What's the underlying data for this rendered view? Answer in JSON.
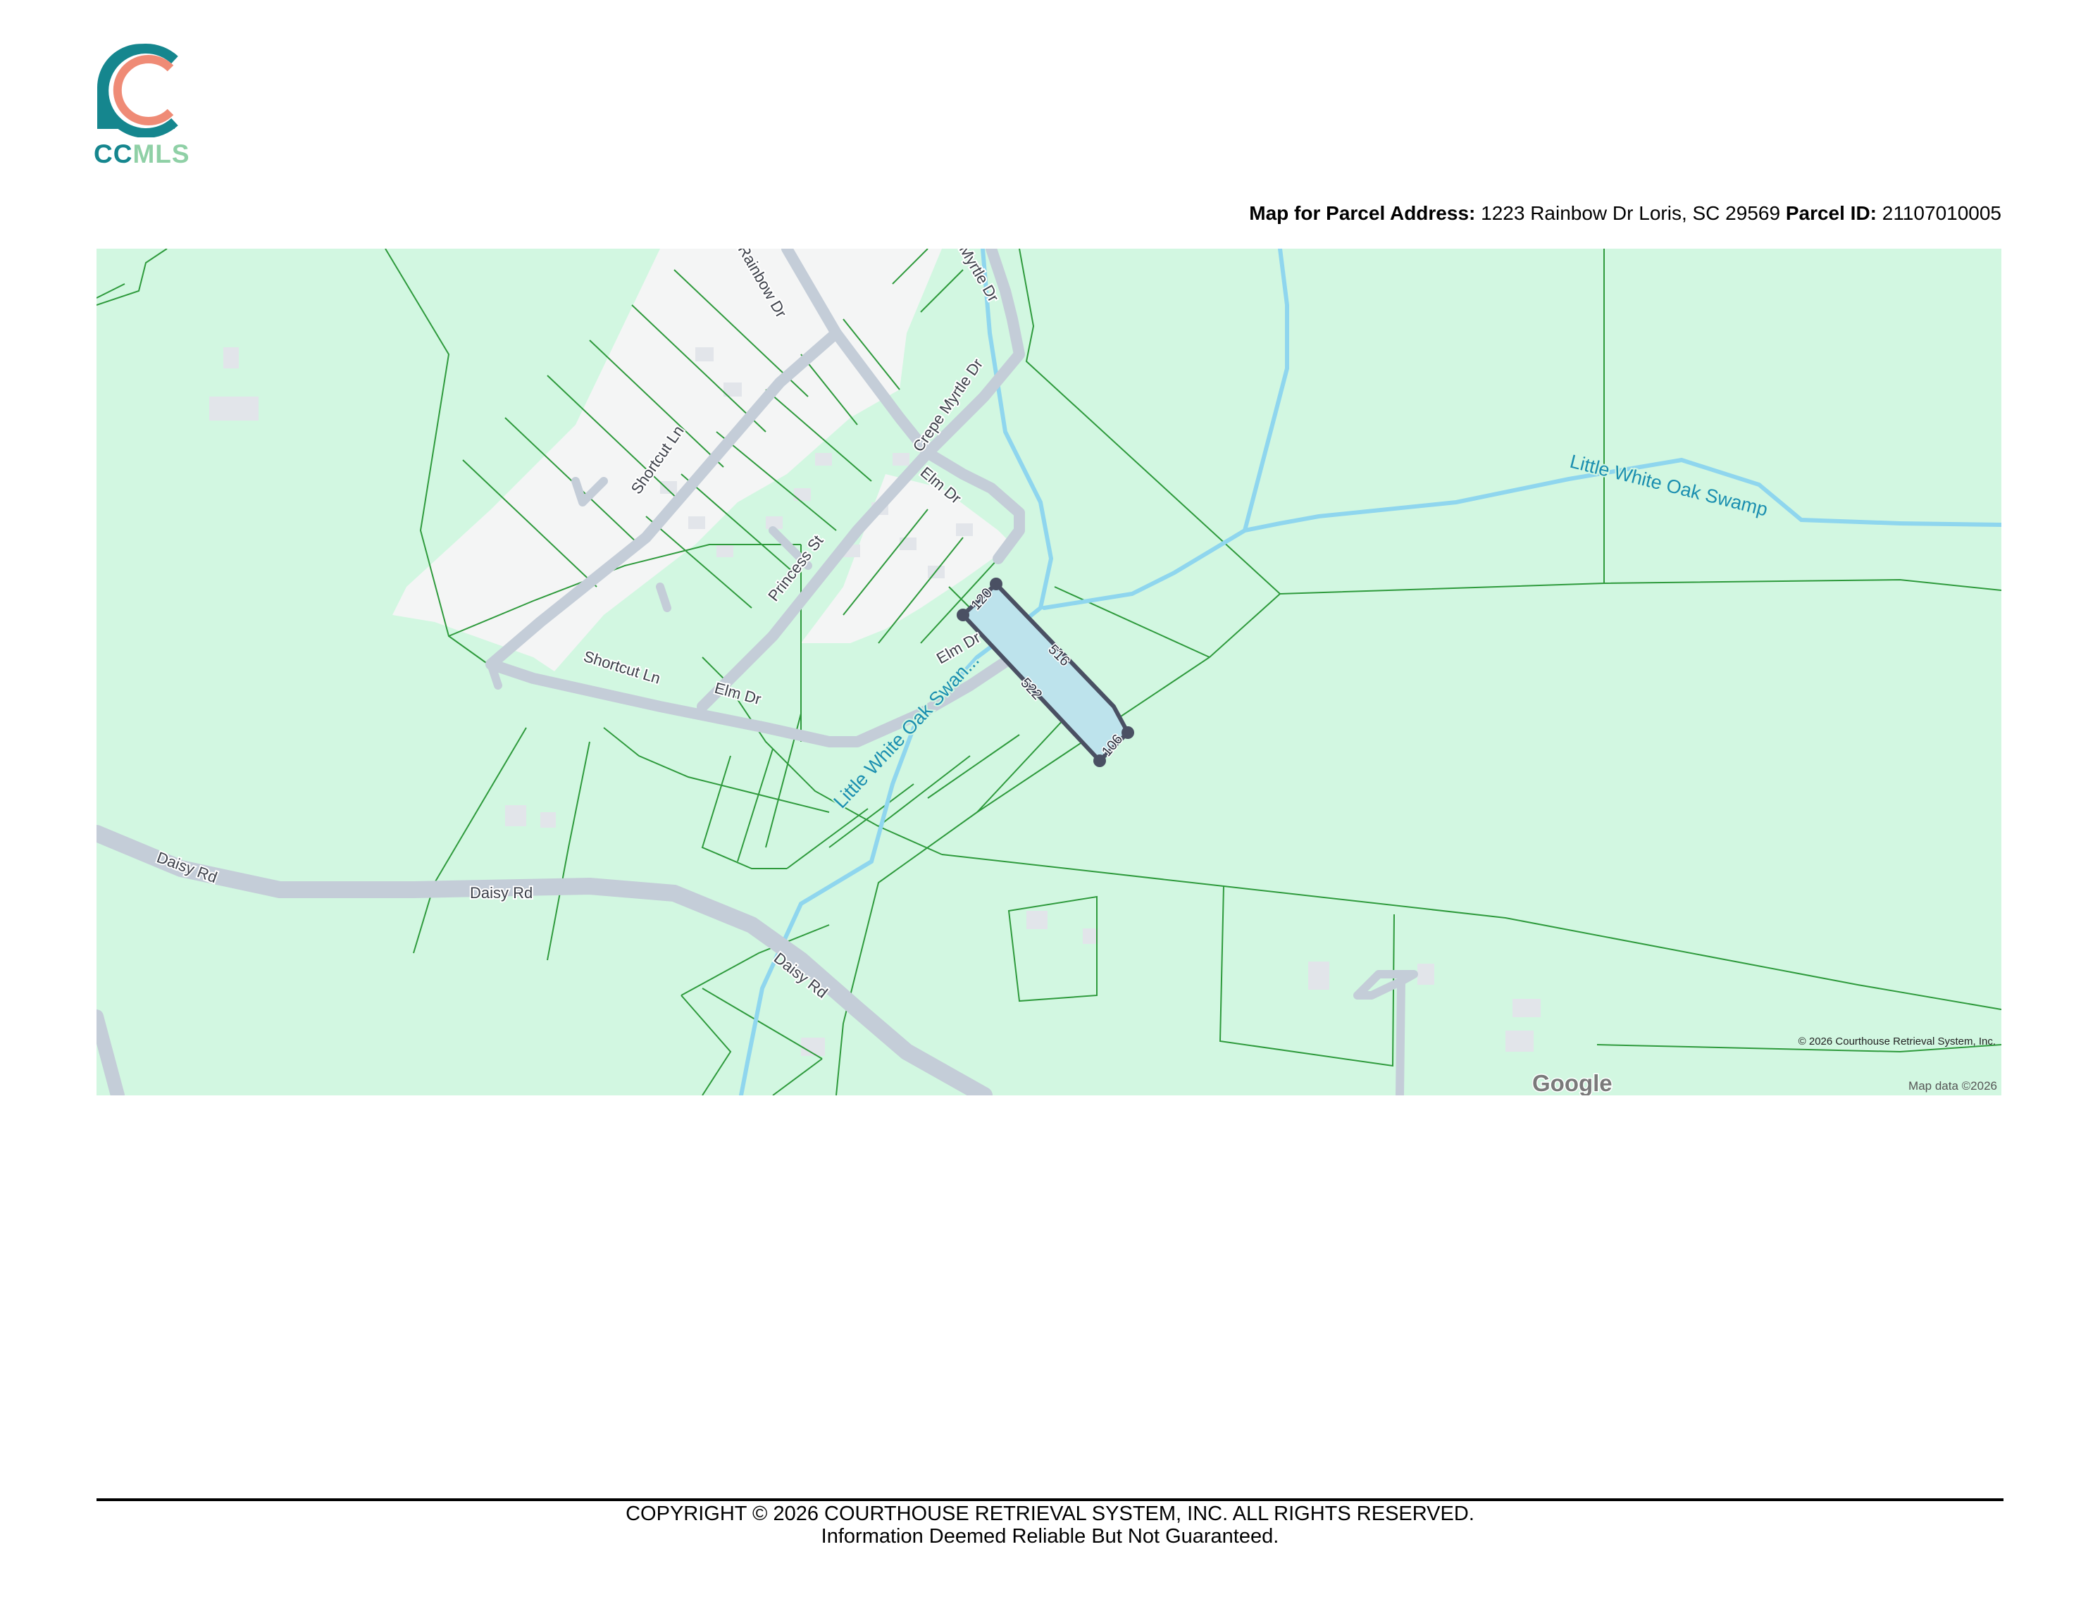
{
  "logo": {
    "brand_cc": "CC",
    "brand_mls": "MLS",
    "colors": {
      "teal": "#15868e",
      "coral": "#ef8b76",
      "mint": "#8fd0a6"
    }
  },
  "header": {
    "address_label": "Map for Parcel Address:",
    "address_value": "1223 Rainbow Dr Loris, SC 29569",
    "parcel_label": "Parcel ID:",
    "parcel_value": "21107010005"
  },
  "map": {
    "colors": {
      "land": "#d2f7e1",
      "parcel_line": "#2e9a3c",
      "road": "#c4cdd8",
      "water": "#8fd6ee",
      "developed": "#f4f5f5",
      "selected_parcel": "#bde3ec",
      "selected_outline": "#4a5063"
    },
    "roads": {
      "rainbow_dr": "Rainbow Dr",
      "myrtle_dr": "Myrtle Dr",
      "crepe_myrtle_dr": "Crepe Myrtle Dr",
      "shortcut_ln_1": "Shortcut Ln",
      "shortcut_ln_2": "Shortcut Ln",
      "elm_dr_1": "Elm Dr",
      "elm_dr_2": "Elm Dr",
      "elm_dr_3": "Elm Dr",
      "princess_st": "Princess St",
      "daisy_rd_1": "Daisy Rd",
      "daisy_rd_2": "Daisy Rd",
      "daisy_rd_3": "Daisy Rd"
    },
    "water": {
      "swamp_east": "Little White Oak Swamp",
      "swamp_west": "Little White Oak Swan..."
    },
    "dimensions": {
      "side_a": "120",
      "side_b": "516",
      "side_c": "522",
      "side_d": "106"
    },
    "attribution": {
      "copyright": "© 2026 Courthouse Retrieval System, Inc.",
      "google": "Google",
      "map_data": "Map data ©2026"
    }
  },
  "footer": {
    "copyright": "COPYRIGHT © 2026 COURTHOUSE RETRIEVAL SYSTEM, INC. ALL RIGHTS RESERVED.",
    "disclaimer": "Information Deemed Reliable But Not Guaranteed."
  }
}
